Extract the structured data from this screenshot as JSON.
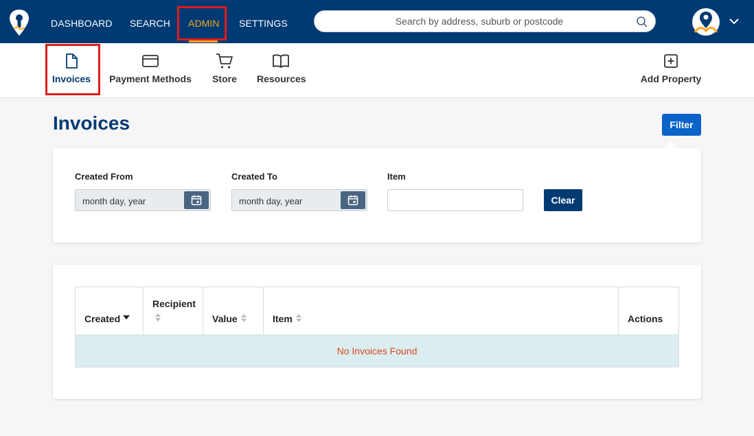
{
  "nav": {
    "items": [
      {
        "label": "DASHBOARD"
      },
      {
        "label": "SEARCH"
      },
      {
        "label": "ADMIN"
      },
      {
        "label": "SETTINGS"
      }
    ],
    "active_color": "#f6a623",
    "bar_color": "#003a73"
  },
  "search": {
    "placeholder": "Search by address, suburb or postcode"
  },
  "subnav": {
    "items": [
      {
        "label": "Invoices",
        "icon": "file-icon"
      },
      {
        "label": "Payment Methods",
        "icon": "credit-card-icon"
      },
      {
        "label": "Store",
        "icon": "cart-icon"
      },
      {
        "label": "Resources",
        "icon": "book-icon"
      }
    ],
    "add_property": {
      "label": "Add Property",
      "icon": "plus-square-icon"
    }
  },
  "page": {
    "title": "Invoices",
    "filter_label": "Filter"
  },
  "filters": {
    "created_from": {
      "label": "Created From",
      "placeholder": "month day, year"
    },
    "created_to": {
      "label": "Created To",
      "placeholder": "month day, year"
    },
    "item": {
      "label": "Item",
      "value": ""
    },
    "clear_label": "Clear"
  },
  "table": {
    "columns": [
      {
        "label": "Created",
        "sort": "desc"
      },
      {
        "label": "Recipient",
        "sort": "none"
      },
      {
        "label": "Value",
        "sort": "none"
      },
      {
        "label": "Item",
        "sort": "none"
      },
      {
        "label": "Actions",
        "sort": null
      }
    ],
    "empty_message": "No Invoices Found"
  }
}
